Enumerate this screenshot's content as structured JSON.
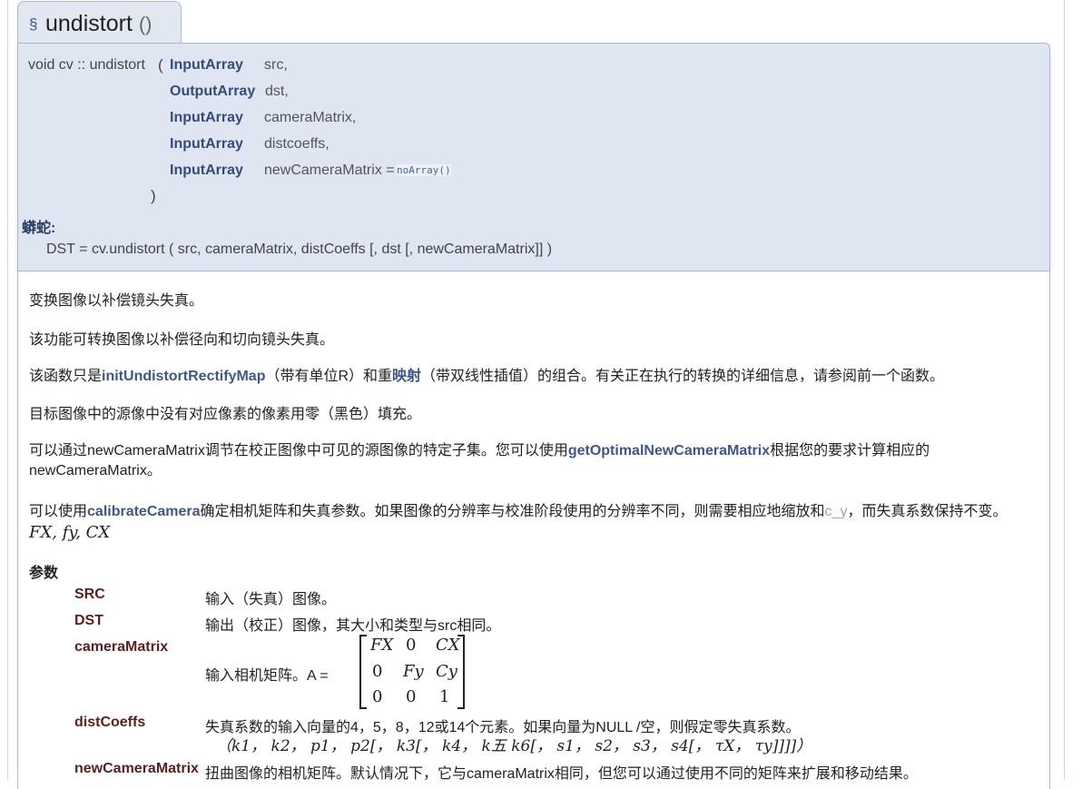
{
  "title": {
    "section_symbol": "§",
    "name": "undistort",
    "parens": "()"
  },
  "prototype": {
    "return_and_name": "void cv :: undistort",
    "open_paren": "(",
    "close_paren": ")",
    "params": [
      {
        "type": "InputArray",
        "name": "src,"
      },
      {
        "type": "OutputArray",
        "name": "dst,"
      },
      {
        "type": "InputArray",
        "name": "cameraMatrix,"
      },
      {
        "type": "InputArray",
        "name": "distcoeffs,"
      },
      {
        "type": "InputArray",
        "name": "newCameraMatrix =",
        "default": "noArray()"
      }
    ],
    "python_label": "蟒蛇:",
    "python_sig": "DST = cv.undistort ( src, cameraMatrix, distCoeffs [, dst [, newCameraMatrix]] )"
  },
  "doc": {
    "p1": "变换图像以补偿镜头失真。",
    "p2": "该功能可转换图像以补偿径向和切向镜头失真。",
    "p3_a": "该函数只是",
    "p3_link1": "initUndistortRectifyMap",
    "p3_b": "（带有单位R）和重",
    "p3_link2": "映射",
    "p3_c": "（带双线性插值）的组合。有关正在执行的转换的详细信息，请参阅前一个函数。",
    "p4": "目标图像中的源像中没有对应像素的像素用零（黑色）填充。",
    "p5_a": "可以通过newCameraMatrix调节在校正图像中可见的源图像的特定子集。您可以使用",
    "p5_link": "getOptimalNewCameraMatrix",
    "p5_b": "根据您的要求计算相应的",
    "p5_c": "newCameraMatrix。",
    "p6_a": "可以使用",
    "p6_link": "calibrateCamera",
    "p6_b": "确定相机矩阵和失真参数。如果图像的分辨率与校准阶段使用的分辨率不同，则需要相应地缩放和",
    "p6_cy": "c_y",
    "p6_c": "，而失真系数保持不变。",
    "p6_math": "FX,  fy, CX",
    "params_heading": "参数",
    "params": [
      {
        "name": "SRC",
        "desc": "输入（失真）图像。"
      },
      {
        "name": "DST",
        "desc": "输出（校正）图像，其大小和类型与src相同。"
      },
      {
        "name": "cameraMatrix",
        "desc": "输入相机矩阵。A  ="
      },
      {
        "name": "distCoeffs",
        "desc": "失真系数的输入向量的4，5，8，12或14个元素。如果向量为NULL /空，则假定零失真系数。"
      },
      {
        "name": "newCameraMatrix",
        "desc": "扭曲图像的相机矩阵。默认情况下，它与cameraMatrix相同，但您可以通过使用不同的矩阵来扩展和移动结果。"
      }
    ],
    "matrix": [
      [
        "FX",
        "0",
        "CX"
      ],
      [
        "0",
        "Fy",
        "Cy"
      ],
      [
        "0",
        "0",
        "1"
      ]
    ],
    "dist_vector": "（k1， k2， p1， p2[， k3[， k4， k五  k6[， s1， s2， s3， s4[， τX， τy]]]]）"
  }
}
